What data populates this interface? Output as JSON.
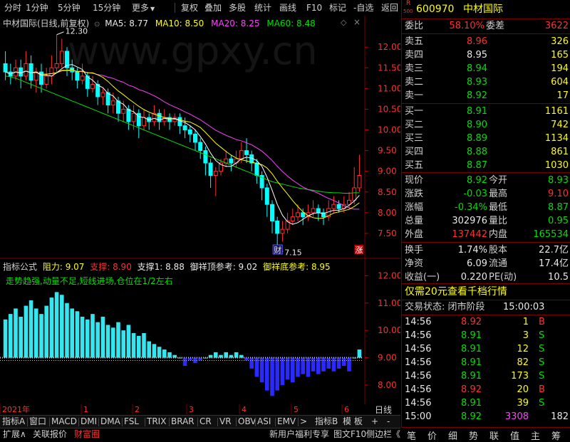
{
  "toolbar": {
    "items": [
      "分时",
      "1分钟",
      "5分钟",
      "15分钟",
      "更多",
      "复权",
      "叠加",
      "多股",
      "统计",
      "画线",
      "F10",
      "标记",
      "-自选",
      "返回"
    ]
  },
  "header": {
    "title": "中材国际(日线,前复权)",
    "ma5_label": "MA5: 8.77",
    "ma10_label": "MA10: 8.50",
    "ma20_label": "MA20: 8.25",
    "ma60_label": "MA60: 8.48",
    "watermark": "www.gpxy.cn"
  },
  "main_axis": {
    "ticks": [
      "12.00",
      "11.50",
      "11.00",
      "10.50",
      "10.00",
      "9.50",
      "9.00",
      "8.50",
      "8.00",
      "7.50"
    ],
    "ylim": [
      7.15,
      12.3
    ]
  },
  "main_annotations": {
    "high": "12.30",
    "low": "7.15",
    "cai_badge": "财",
    "zhang_badge": "涨"
  },
  "indicator": {
    "name": "指标公式",
    "zuli": "阻力: 9.07",
    "zhicheng": "支撑: 8.90",
    "zhicheng1": "支撑1: 8.88",
    "top_ref": "御祥顶参考: 9.02",
    "bottom_ref": "御祥底参考: 8.95",
    "signal_text": "走势趋强,动量不足,短线进场,仓位在1/2左右",
    "axis_ticks": [
      "12.00",
      "11.00",
      "10.00",
      "9.00",
      "8.00"
    ],
    "baseline": 9.0,
    "ylim": [
      7.4,
      12.4
    ]
  },
  "chart_data": {
    "type": "candlestick",
    "title": "中材国际(日线,前复权)",
    "ma_labels": {
      "MA5": 8.77,
      "MA10": 8.5,
      "MA20": 8.25,
      "MA60": 8.48
    },
    "y_range": [
      7.15,
      12.3
    ],
    "high_marker": 12.3,
    "low_marker": 7.15,
    "x_ticks": [
      "2021年",
      "1",
      "2",
      "3",
      "4",
      "5",
      "6"
    ],
    "x_axis_label": "日线",
    "candles": [
      [
        11.6,
        11.4,
        11.9,
        11.2
      ],
      [
        11.4,
        11.3,
        11.6,
        11.1
      ],
      [
        11.3,
        11.5,
        11.7,
        11.2
      ],
      [
        11.5,
        11.3,
        11.7,
        11.0
      ],
      [
        11.3,
        11.6,
        11.9,
        11.2
      ],
      [
        11.6,
        11.2,
        11.8,
        11.0
      ],
      [
        11.2,
        11.4,
        11.5,
        10.9
      ],
      [
        11.4,
        11.1,
        11.6,
        10.9
      ],
      [
        11.1,
        11.3,
        11.5,
        11.0
      ],
      [
        11.3,
        11.5,
        11.8,
        11.1
      ],
      [
        11.5,
        11.6,
        12.3,
        11.4
      ],
      [
        11.6,
        11.9,
        12.2,
        11.5
      ],
      [
        11.9,
        11.5,
        12.0,
        11.3
      ],
      [
        11.5,
        11.4,
        11.7,
        11.2
      ],
      [
        11.4,
        11.2,
        11.5,
        11.0
      ],
      [
        11.2,
        11.3,
        11.6,
        11.1
      ],
      [
        11.3,
        11.0,
        11.4,
        10.8
      ],
      [
        11.0,
        11.1,
        11.3,
        10.9
      ],
      [
        11.1,
        10.8,
        11.2,
        10.6
      ],
      [
        10.8,
        10.9,
        11.0,
        10.6
      ],
      [
        10.9,
        10.6,
        11.0,
        10.4
      ],
      [
        10.6,
        10.7,
        10.9,
        10.4
      ],
      [
        10.7,
        10.4,
        10.8,
        10.2
      ],
      [
        10.4,
        10.5,
        10.7,
        10.2
      ],
      [
        10.5,
        10.2,
        10.6,
        10.0
      ],
      [
        10.2,
        10.4,
        10.6,
        10.0
      ],
      [
        10.4,
        10.1,
        10.5,
        9.8
      ],
      [
        10.1,
        10.3,
        10.5,
        10.0
      ],
      [
        10.3,
        10.2,
        10.4,
        10.0
      ],
      [
        10.2,
        10.4,
        10.6,
        10.1
      ],
      [
        10.4,
        10.2,
        10.5,
        10.0
      ],
      [
        10.2,
        10.3,
        10.5,
        10.1
      ],
      [
        10.3,
        10.2,
        10.4,
        10.0
      ],
      [
        10.2,
        10.3,
        10.4,
        10.1
      ],
      [
        10.3,
        10.1,
        10.4,
        9.9
      ],
      [
        10.1,
        10.0,
        10.3,
        9.8
      ],
      [
        10.0,
        9.9,
        10.1,
        9.7
      ],
      [
        9.9,
        9.7,
        10.0,
        9.5
      ],
      [
        9.7,
        9.5,
        9.8,
        9.3
      ],
      [
        9.5,
        9.2,
        9.6,
        8.9
      ],
      [
        9.2,
        8.9,
        9.3,
        8.6
      ],
      [
        8.9,
        9.0,
        9.1,
        8.4
      ],
      [
        9.0,
        9.2,
        9.3,
        8.9
      ],
      [
        9.2,
        9.3,
        9.5,
        9.1
      ],
      [
        9.3,
        9.2,
        9.4,
        9.0
      ],
      [
        9.2,
        9.3,
        9.5,
        9.1
      ],
      [
        9.3,
        9.5,
        9.7,
        9.2
      ],
      [
        9.5,
        9.4,
        9.8,
        9.2
      ],
      [
        9.4,
        9.2,
        9.5,
        9.0
      ],
      [
        9.2,
        8.9,
        9.3,
        8.7
      ],
      [
        8.9,
        8.6,
        9.0,
        8.3
      ],
      [
        8.6,
        8.2,
        8.7,
        7.9
      ],
      [
        8.2,
        7.8,
        8.3,
        7.5
      ],
      [
        7.8,
        7.5,
        7.9,
        7.15
      ],
      [
        7.5,
        7.6,
        7.8,
        7.3
      ],
      [
        7.6,
        7.8,
        8.0,
        7.5
      ],
      [
        7.8,
        7.9,
        8.1,
        7.7
      ],
      [
        7.9,
        8.0,
        8.2,
        7.8
      ],
      [
        8.0,
        7.9,
        8.1,
        7.7
      ],
      [
        7.9,
        8.0,
        8.2,
        7.8
      ],
      [
        8.0,
        8.1,
        8.3,
        7.9
      ],
      [
        8.1,
        8.0,
        8.2,
        7.8
      ],
      [
        8.0,
        7.9,
        8.1,
        7.7
      ],
      [
        7.9,
        8.1,
        8.3,
        7.8
      ],
      [
        8.1,
        8.2,
        8.4,
        8.0
      ],
      [
        8.2,
        8.1,
        8.3,
        8.0
      ],
      [
        8.1,
        8.2,
        8.4,
        8.0
      ],
      [
        8.2,
        8.3,
        8.5,
        8.1
      ],
      [
        8.3,
        8.6,
        9.1,
        8.2
      ],
      [
        8.6,
        8.9,
        9.4,
        8.5
      ]
    ],
    "ma60": [
      11.3,
      11.28,
      11.25,
      11.2,
      11.15,
      11.1,
      11.05,
      11.0,
      10.95,
      10.9,
      10.85,
      10.8,
      10.75,
      10.7,
      10.65,
      10.6,
      10.55,
      10.5,
      10.45,
      10.4,
      10.35,
      10.3,
      10.25,
      10.2,
      10.15,
      10.1,
      10.05,
      10.0,
      9.95,
      9.9,
      9.85,
      9.8,
      9.75,
      9.7,
      9.65,
      9.6,
      9.55,
      9.5,
      9.45,
      9.4,
      9.35,
      9.3,
      9.25,
      9.2,
      9.15,
      9.1,
      9.05,
      9.0,
      8.95,
      8.9,
      8.85,
      8.8,
      8.75,
      8.72,
      8.69,
      8.66,
      8.63,
      8.6,
      8.58,
      8.56,
      8.54,
      8.52,
      8.5,
      8.49,
      8.48,
      8.48,
      8.47,
      8.47,
      8.48,
      8.48
    ],
    "indicator_bars": [
      10.4,
      10.6,
      10.8,
      10.5,
      10.9,
      11.1,
      10.8,
      10.6,
      10.9,
      11.2,
      11.4,
      11.3,
      11.0,
      10.8,
      10.7,
      10.5,
      10.4,
      10.6,
      10.3,
      10.5,
      10.2,
      10.1,
      10.3,
      10.0,
      10.2,
      9.9,
      9.8,
      9.9,
      9.6,
      9.5,
      9.4,
      9.3,
      9.2,
      9.1,
      9.0,
      8.7,
      8.9,
      8.8,
      8.9,
      9.0,
      9.1,
      9.2,
      9.1,
      9.2,
      9.1,
      9.2,
      9.1,
      8.9,
      8.6,
      8.3,
      8.1,
      7.8,
      7.6,
      7.8,
      8.0,
      8.2,
      8.1,
      8.3,
      8.4,
      8.3,
      8.5,
      8.4,
      8.5,
      8.6,
      8.5,
      8.6,
      8.7,
      8.5,
      9.0,
      9.3
    ],
    "indicator_ref_line": 9.0
  },
  "quote": {
    "code": "600970",
    "name": "中材国际",
    "r_badge": "R",
    "r_sub": "500",
    "weibi_label": "委比",
    "weibi": "58.10%",
    "weicha_label": "委差",
    "weicha": "3622",
    "asks": [
      {
        "label": "卖五",
        "price": "8.96",
        "vol": "326",
        "cls": "red"
      },
      {
        "label": "卖四",
        "price": "8.95",
        "vol": "165",
        "cls": "wht"
      },
      {
        "label": "卖三",
        "price": "8.94",
        "vol": "194",
        "cls": "grn"
      },
      {
        "label": "卖二",
        "price": "8.93",
        "vol": "604",
        "cls": "grn"
      },
      {
        "label": "卖一",
        "price": "8.92",
        "vol": "17",
        "cls": "grn"
      }
    ],
    "bids": [
      {
        "label": "买一",
        "price": "8.91",
        "vol": "1161",
        "cls": "grn"
      },
      {
        "label": "买二",
        "price": "8.90",
        "vol": "742",
        "cls": "grn"
      },
      {
        "label": "买三",
        "price": "8.89",
        "vol": "1134",
        "cls": "grn"
      },
      {
        "label": "买四",
        "price": "8.88",
        "vol": "861",
        "cls": "grn"
      },
      {
        "label": "买五",
        "price": "8.87",
        "vol": "1030",
        "cls": "grn"
      }
    ],
    "stats": [
      {
        "l1": "现价",
        "v1": "8.92",
        "c1": "grn",
        "l2": "今开",
        "v2": "8.93",
        "c2": "grn"
      },
      {
        "l1": "涨跌",
        "v1": "-0.03",
        "c1": "grn",
        "l2": "最高",
        "v2": "9.10",
        "c2": "red"
      },
      {
        "l1": "涨幅",
        "v1": "-0.34%",
        "c1": "grn",
        "l2": "最低",
        "v2": "8.87",
        "c2": "grn"
      },
      {
        "l1": "总量",
        "v1": "302976",
        "c1": "wht",
        "l2": "量比",
        "v2": "0.95",
        "c2": "grn"
      },
      {
        "l1": "外盘",
        "v1": "137442",
        "c1": "red",
        "l2": "内盘",
        "v2": "165534",
        "c2": "grn"
      }
    ],
    "stats2": [
      {
        "l1": "换手",
        "v1": "1.74%",
        "l2": "股本",
        "v2": "22.7亿"
      },
      {
        "l1": "净资",
        "v1": "6.09",
        "l2": "流通",
        "v2": "17.4亿"
      },
      {
        "l1": "收益(一)",
        "v1": "0.220",
        "l2": "PE(动)",
        "v2": "10.5"
      }
    ],
    "promo": "仅需20元查看千档行情",
    "trade_status": "交易状态: 闭市阶段",
    "trade_time": "15:00:03",
    "ticks": [
      {
        "t": "14:56",
        "p": "8.92",
        "v": "1",
        "s": "B",
        "pc": "red",
        "sc": "red",
        "vc": "yel"
      },
      {
        "t": "14:56",
        "p": "8.91",
        "v": "3",
        "s": "S",
        "pc": "grn",
        "sc": "grn",
        "vc": "yel"
      },
      {
        "t": "14:56",
        "p": "8.91",
        "v": "12",
        "s": "S",
        "pc": "grn",
        "sc": "grn",
        "vc": "yel"
      },
      {
        "t": "14:56",
        "p": "8.91",
        "v": "82",
        "s": "S",
        "pc": "grn",
        "sc": "grn",
        "vc": "yel"
      },
      {
        "t": "14:56",
        "p": "8.91",
        "v": "173",
        "s": "S",
        "pc": "grn",
        "sc": "grn",
        "vc": "yel"
      },
      {
        "t": "14:56",
        "p": "8.92",
        "v": "20",
        "s": "B",
        "pc": "red",
        "sc": "red",
        "vc": "yel"
      },
      {
        "t": "14:56",
        "p": "8.91",
        "v": "39",
        "s": "S",
        "pc": "grn",
        "sc": "grn",
        "vc": "yel"
      },
      {
        "t": "15:00",
        "p": "8.92",
        "v": "3308",
        "s": "182",
        "pc": "grn",
        "sc": "wht",
        "vc": "mag"
      }
    ],
    "bottom_tabs": [
      "笔",
      "价",
      "细",
      "势",
      "联",
      "值",
      "主",
      "筹"
    ]
  },
  "tabs": {
    "items": [
      "指标A",
      "窗口",
      "MACD",
      "DMI",
      "DMA",
      "FSL",
      "TRIX",
      "BRAR",
      "CR",
      "VR",
      "OBV",
      "ASI",
      "EMV",
      ">",
      "指标B",
      "模 板",
      "+",
      "-"
    ]
  },
  "status": {
    "items": [
      "扩展∧",
      "关联报价",
      "财富圈"
    ],
    "right_items": [
      "新用户福利专享",
      "图文F10",
      "侧边栏《"
    ]
  },
  "colors": {
    "up": "#ff3030",
    "down": "#00ffff",
    "ma5": "#ffffff",
    "ma10": "#ffff00",
    "ma20": "#ff40ff",
    "ma60": "#00e000",
    "border": "#7a0000",
    "accent": "#ffff00"
  }
}
